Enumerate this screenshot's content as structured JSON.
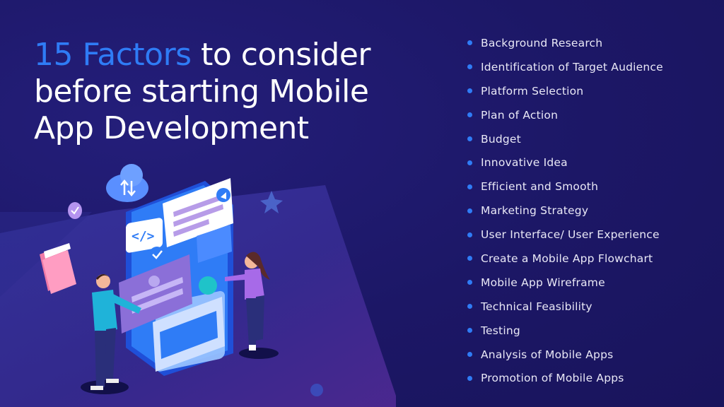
{
  "title": {
    "accent": "15 Factors",
    "rest_line1": " to consider",
    "line2": "before starting Mobile",
    "line3": "App Development"
  },
  "factors": [
    "Background Research",
    "Identification of Target Audience",
    "Platform Selection",
    "Plan of Action",
    "Budget",
    "Innovative Idea",
    "Efficient and Smooth",
    "Marketing Strategy",
    "User Interface/ User Experience",
    "Create a Mobile App Flowchart",
    "Mobile App Wireframe",
    "Technical Feasibility",
    "Testing",
    "Analysis of Mobile Apps",
    "Promotion of Mobile Apps"
  ],
  "colors": {
    "background": "#1c1766",
    "accent": "#2f7cf6",
    "text": "#ffffff",
    "bullet": "#2f7cf6"
  },
  "illustration": {
    "code_icon_text": "</>",
    "icons": [
      "cloud-sync-icon",
      "check-badge-icon",
      "star-icon",
      "folder-icon",
      "gear-icon",
      "share-icon",
      "play-icon",
      "code-icon"
    ]
  }
}
